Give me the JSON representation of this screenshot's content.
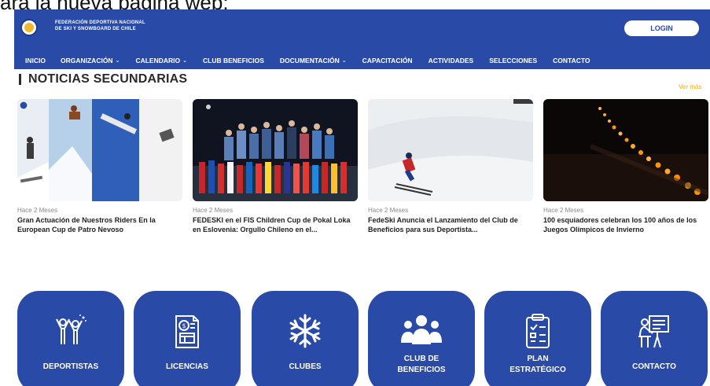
{
  "caption": "ara la nueva página web:",
  "header": {
    "org_line1": "FEDERACIÓN DEPORTIVA NACIONAL",
    "org_line2": "DE SKI Y SNOWBOARD DE CHILE",
    "login_label": "LOGIN",
    "brand_color": "#2a4aa8"
  },
  "nav": [
    {
      "label": "INICIO",
      "dropdown": false
    },
    {
      "label": "ORGANIZACIÓN",
      "dropdown": true
    },
    {
      "label": "CALENDARIO",
      "dropdown": true
    },
    {
      "label": "CLUB BENEFICIOS",
      "dropdown": false
    },
    {
      "label": "DOCUMENTACIÓN",
      "dropdown": true
    },
    {
      "label": "CAPACITACIÓN",
      "dropdown": false
    },
    {
      "label": "ACTIVIDADES",
      "dropdown": false
    },
    {
      "label": "SELECCIONES",
      "dropdown": false
    },
    {
      "label": "CONTACTO",
      "dropdown": false
    }
  ],
  "section": {
    "title": "NOTICIAS SECUNDARIAS",
    "more_label": "Ver más",
    "accent": "#f2a900"
  },
  "news": [
    {
      "meta": "Hace 2 Meses",
      "title": "Gran Actuación de Nuestros Riders En la European Cup de Patro Nevoso",
      "image": "snowboard-collage"
    },
    {
      "meta": "Hace 2 Meses",
      "title": "FEDESKI en el FIS Children Cup de Pokal Loka en Eslovenia: Orgullo Chileno en el...",
      "image": "team-flags-night"
    },
    {
      "meta": "Hace 2 Meses",
      "title": "FedeSki Anuncia el Lanzamiento del Club de Beneficios para sus Deportista...",
      "image": "skier-slope"
    },
    {
      "meta": "Hace 2 Meses",
      "title": "100 esquiadores celebran los 100 años de los Juegos Olímpicos de Invierno",
      "image": "torch-night"
    }
  ],
  "tiles": [
    {
      "label": "DEPORTISTAS",
      "icon": "athletes-icon"
    },
    {
      "label": "LICENCIAS",
      "icon": "license-icon"
    },
    {
      "label": "CLUBES",
      "icon": "snowflake-icon"
    },
    {
      "label_line1": "CLUB DE",
      "label_line2": "BENEFICIOS",
      "icon": "group-icon"
    },
    {
      "label_line1": "PLAN",
      "label_line2": "ESTRATÉGICO",
      "icon": "clipboard-icon"
    },
    {
      "label": "CONTACTO",
      "icon": "presenter-icon"
    }
  ]
}
